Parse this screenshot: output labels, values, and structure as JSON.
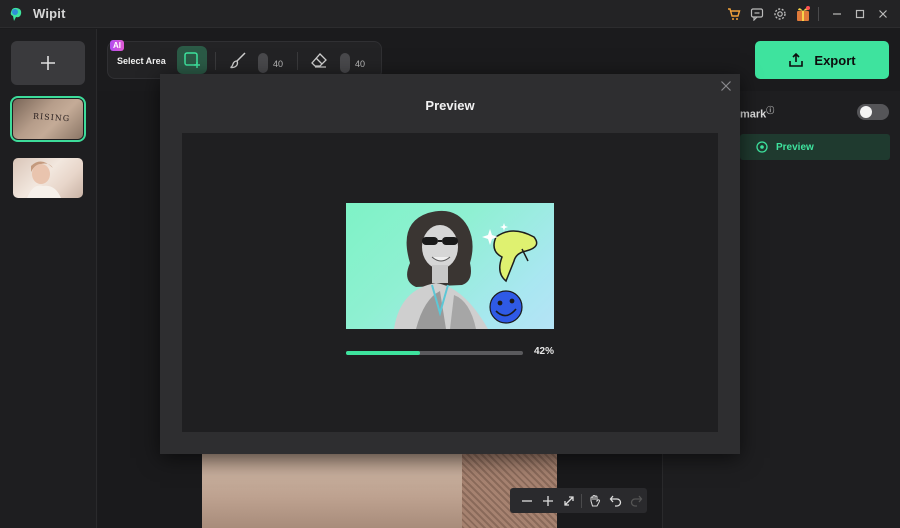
{
  "app": {
    "title": "Wipit",
    "logo_icon": "wipit-logo-icon"
  },
  "titlebar": {
    "icons": [
      "cart-icon",
      "feedback-icon",
      "settings-icon",
      "gift-icon"
    ],
    "window_controls": [
      "minimize-icon",
      "maximize-icon",
      "close-icon"
    ]
  },
  "sidebar": {
    "add_label": "+",
    "thumbnails": [
      {
        "name": "tattoo-arm-thumbnail",
        "text": "RISING",
        "selected": true
      },
      {
        "name": "woman-photo-thumbnail",
        "selected": false
      }
    ]
  },
  "toolbar": {
    "ai_badge": "AI",
    "select_area_label": "Select Area",
    "brush_size": "40",
    "eraser_size": "40"
  },
  "export": {
    "label": "Export"
  },
  "right_panel": {
    "watermark_label": "mark",
    "watermark_toggle": false,
    "preview_label": "Preview"
  },
  "modal": {
    "title": "Preview",
    "progress_percent": 42,
    "progress_text": "42%"
  },
  "zoom_bar": {
    "buttons": [
      "zoom-out-icon",
      "zoom-in-icon",
      "fit-icon",
      "hand-icon",
      "undo-icon",
      "redo-icon"
    ]
  },
  "colors": {
    "accent": "#3ee39e",
    "ai_badge": "#c04ee6",
    "background": "#1b1b1d",
    "modal": "#2e2e30"
  }
}
